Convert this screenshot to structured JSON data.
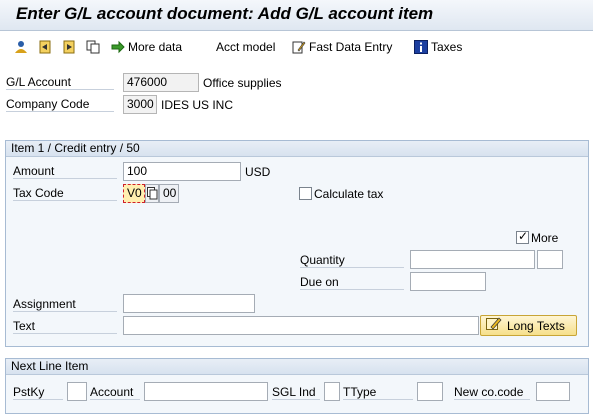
{
  "title": "Enter G/L account document: Add G/L account item",
  "toolbar": {
    "more_data": "More data",
    "acct_model": "Acct model",
    "fast_data_entry": "Fast Data Entry",
    "taxes": "Taxes"
  },
  "header": {
    "gl_account_label": "G/L Account",
    "gl_account_value": "476000",
    "gl_account_desc": "Office supplies",
    "company_code_label": "Company Code",
    "company_code_value": "3000",
    "company_code_desc": "IDES US INC"
  },
  "item_group": {
    "title": "Item 1 / Credit entry / 50",
    "amount_label": "Amount",
    "amount_value": "100",
    "currency": "USD",
    "tax_code_label": "Tax Code",
    "tax_code_value": "V0",
    "tax_code_extra": "00",
    "calculate_tax_label": "Calculate tax",
    "calculate_tax_checked": false,
    "more_label": "More",
    "more_checked": true,
    "quantity_label": "Quantity",
    "due_on_label": "Due on",
    "assignment_label": "Assignment",
    "text_label": "Text",
    "long_texts_button": "Long Texts"
  },
  "next_line": {
    "title": "Next Line Item",
    "pstky_label": "PstKy",
    "account_label": "Account",
    "sgl_ind_label": "SGL Ind",
    "ttype_label": "TType",
    "new_cocode_label": "New co.code"
  }
}
